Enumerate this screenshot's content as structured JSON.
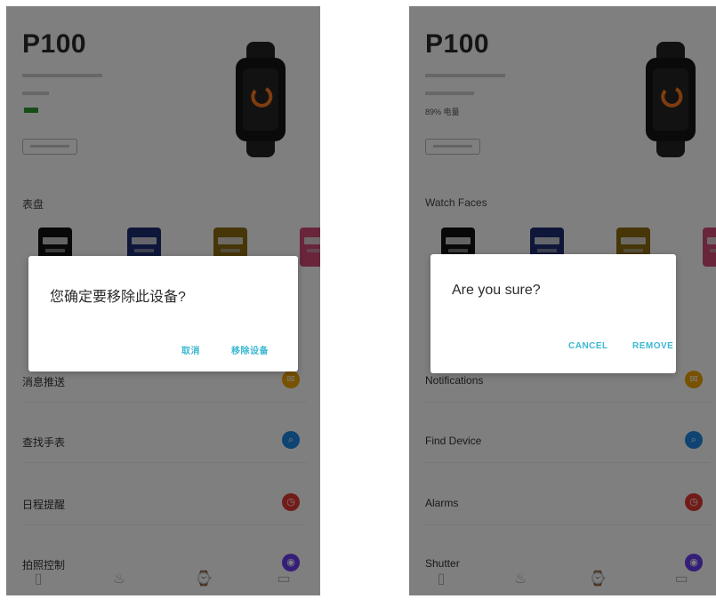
{
  "screens": [
    {
      "title": "P100",
      "battery": "",
      "section": "表盘",
      "rows": [
        {
          "label": "消息推送",
          "icon": "bell-icon",
          "color": "#f0a500",
          "glyph": "✉"
        },
        {
          "label": "查找手表",
          "icon": "search-icon",
          "color": "#1e88e5",
          "glyph": "⌕"
        },
        {
          "label": "日程提醒",
          "icon": "alarm-icon",
          "color": "#e53935",
          "glyph": "◷"
        },
        {
          "label": "拍照控制",
          "icon": "camera-icon",
          "color": "#6a3df0",
          "glyph": "◉"
        }
      ],
      "dialog": {
        "message": "您确定要移除此设备?",
        "cancel": "取消",
        "ok": "移除设备"
      }
    },
    {
      "title": "P100",
      "battery": "89% 电量",
      "section": "Watch Faces",
      "rows": [
        {
          "label": "Notifications",
          "icon": "bell-icon",
          "color": "#f0a500",
          "glyph": "✉"
        },
        {
          "label": "Find Device",
          "icon": "search-icon",
          "color": "#1e88e5",
          "glyph": "⌕"
        },
        {
          "label": "Alarms",
          "icon": "alarm-icon",
          "color": "#e53935",
          "glyph": "◷"
        },
        {
          "label": "Shutter",
          "icon": "camera-icon",
          "color": "#6a3df0",
          "glyph": "◉"
        }
      ],
      "dialog": {
        "message": "Are you sure?",
        "cancel": "CANCEL",
        "ok": "REMOVE"
      }
    }
  ],
  "nav_tabs": [
    {
      "icon": "device-icon",
      "glyph": "▯"
    },
    {
      "icon": "activity-icon",
      "glyph": "♨"
    },
    {
      "icon": "watch-icon",
      "glyph": "⌚",
      "active_color": "#3bb8d2"
    },
    {
      "icon": "profile-icon",
      "glyph": "▭"
    }
  ]
}
